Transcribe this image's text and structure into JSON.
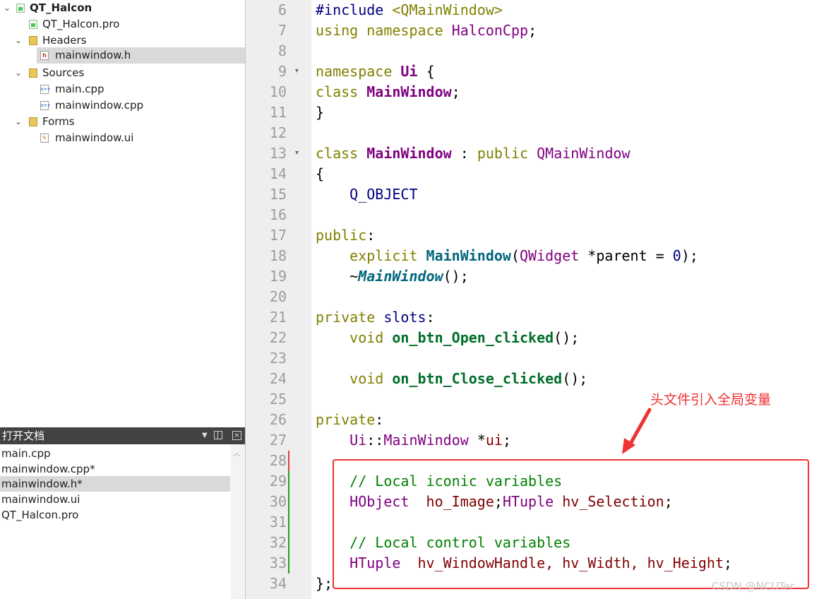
{
  "project_tree": {
    "root": "QT_Halcon",
    "items": {
      "pro": "QT_Halcon.pro",
      "headers": "Headers",
      "mainwindow_h": "mainwindow.h",
      "sources": "Sources",
      "main_cpp": "main.cpp",
      "mainwindow_cpp": "mainwindow.cpp",
      "forms": "Forms",
      "mainwindow_ui": "mainwindow.ui"
    },
    "selected": "mainwindow.h",
    "icons": {
      "h_file": "h",
      "cpp_file": "c++"
    }
  },
  "open_documents": {
    "title": "打开文档",
    "items": [
      "main.cpp",
      "mainwindow.cpp*",
      "mainwindow.h*",
      "mainwindow.ui",
      "QT_Halcon.pro"
    ],
    "selected_index": 2,
    "dropdown_icon": "triangle-down-icon",
    "close_icon": "×"
  },
  "editor": {
    "file": "mainwindow.h",
    "line_numbers": [
      "6",
      "7",
      "8",
      "9",
      "10",
      "11",
      "12",
      "13",
      "14",
      "15",
      "16",
      "17",
      "18",
      "19",
      "20",
      "21",
      "22",
      "23",
      "24",
      "25",
      "26",
      "27",
      "28",
      "29",
      "30",
      "31",
      "32",
      "33",
      "34"
    ],
    "fold_markers": [
      "▾",
      "▾"
    ],
    "modified_line_colors": {
      "removed": "#e23c3c",
      "added": "#20a020"
    },
    "code": {
      "include_dir": "#include",
      "include_path": " <QMainWindow>",
      "using": "using",
      "namespace": "namespace",
      "halconcpp": "HalconCpp",
      "semicolon": ";",
      "ui_ns": "Ui",
      "open_brace": "{",
      "close_brace": "}",
      "class_kw": "class",
      "mainwindow": "MainWindow",
      "colon_sep": " : ",
      "public_kw": "public",
      "qmainwindow": "QMainWindow",
      "q_object": "Q_OBJECT",
      "public_label": "public",
      "colon": ":",
      "explicit": "explicit",
      "ctor_open": "(",
      "qwidget": "QWidget",
      "ctor_param": " *parent = ",
      "zero": "0",
      "ctor_close": ");",
      "tilde": "~",
      "paren_semi": "();",
      "private_kw": "private",
      "slots_kw": "slots",
      "void_kw": "void",
      "slot_open": "on_btn_Open_clicked",
      "slot_close": "on_btn_Close_clicked",
      "ui_decl_sep": "::",
      "ui_ptr": " *",
      "ui_member": "ui",
      "comment_iconic": "// Local iconic variables",
      "hobject": "HObject",
      "ho_image": "  ho_Image",
      "htuple": "HTuple",
      "hv_selection": " hv_Selection",
      "comment_control": "// Local control variables",
      "hv_decl": "  hv_WindowHandle, hv_Width, hv_Height",
      "class_end": "};"
    }
  },
  "annotation": {
    "text": "头文件引入全局变量",
    "color": "#f03232"
  },
  "watermark": "CSDN @NCUTer"
}
